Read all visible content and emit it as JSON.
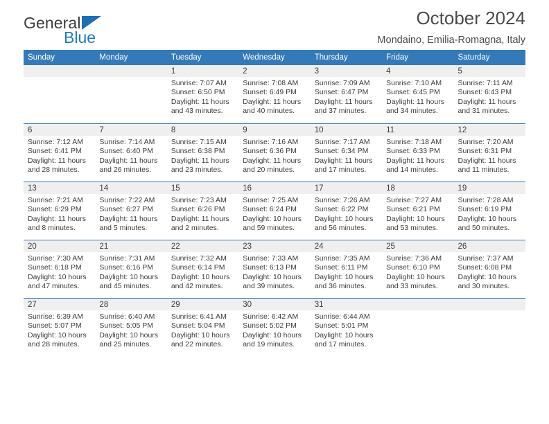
{
  "brand": {
    "name_top": "General",
    "name_bottom": "Blue",
    "triangle_color": "#1f6fb5",
    "blue_text_color": "#1f7ac0"
  },
  "header": {
    "title": "October 2024",
    "subtitle": "Mondaino, Emilia-Romagna, Italy"
  },
  "theme": {
    "header_bg": "#357ab8",
    "header_text": "#ffffff",
    "daynum_band_bg": "#efefef",
    "separator": "#357ab8",
    "body_text": "#3c3c3c"
  },
  "calendar": {
    "weekday_headers": [
      "Sunday",
      "Monday",
      "Tuesday",
      "Wednesday",
      "Thursday",
      "Friday",
      "Saturday"
    ],
    "labels": {
      "sunrise": "Sunrise:",
      "sunset": "Sunset:",
      "daylight": "Daylight:"
    },
    "weeks": [
      [
        {
          "day": "",
          "sunrise": "",
          "sunset": "",
          "daylight": ""
        },
        {
          "day": "",
          "sunrise": "",
          "sunset": "",
          "daylight": ""
        },
        {
          "day": "1",
          "sunrise": "Sunrise: 7:07 AM",
          "sunset": "Sunset: 6:50 PM",
          "daylight": "Daylight: 11 hours and 43 minutes."
        },
        {
          "day": "2",
          "sunrise": "Sunrise: 7:08 AM",
          "sunset": "Sunset: 6:49 PM",
          "daylight": "Daylight: 11 hours and 40 minutes."
        },
        {
          "day": "3",
          "sunrise": "Sunrise: 7:09 AM",
          "sunset": "Sunset: 6:47 PM",
          "daylight": "Daylight: 11 hours and 37 minutes."
        },
        {
          "day": "4",
          "sunrise": "Sunrise: 7:10 AM",
          "sunset": "Sunset: 6:45 PM",
          "daylight": "Daylight: 11 hours and 34 minutes."
        },
        {
          "day": "5",
          "sunrise": "Sunrise: 7:11 AM",
          "sunset": "Sunset: 6:43 PM",
          "daylight": "Daylight: 11 hours and 31 minutes."
        }
      ],
      [
        {
          "day": "6",
          "sunrise": "Sunrise: 7:12 AM",
          "sunset": "Sunset: 6:41 PM",
          "daylight": "Daylight: 11 hours and 28 minutes."
        },
        {
          "day": "7",
          "sunrise": "Sunrise: 7:14 AM",
          "sunset": "Sunset: 6:40 PM",
          "daylight": "Daylight: 11 hours and 26 minutes."
        },
        {
          "day": "8",
          "sunrise": "Sunrise: 7:15 AM",
          "sunset": "Sunset: 6:38 PM",
          "daylight": "Daylight: 11 hours and 23 minutes."
        },
        {
          "day": "9",
          "sunrise": "Sunrise: 7:16 AM",
          "sunset": "Sunset: 6:36 PM",
          "daylight": "Daylight: 11 hours and 20 minutes."
        },
        {
          "day": "10",
          "sunrise": "Sunrise: 7:17 AM",
          "sunset": "Sunset: 6:34 PM",
          "daylight": "Daylight: 11 hours and 17 minutes."
        },
        {
          "day": "11",
          "sunrise": "Sunrise: 7:18 AM",
          "sunset": "Sunset: 6:33 PM",
          "daylight": "Daylight: 11 hours and 14 minutes."
        },
        {
          "day": "12",
          "sunrise": "Sunrise: 7:20 AM",
          "sunset": "Sunset: 6:31 PM",
          "daylight": "Daylight: 11 hours and 11 minutes."
        }
      ],
      [
        {
          "day": "13",
          "sunrise": "Sunrise: 7:21 AM",
          "sunset": "Sunset: 6:29 PM",
          "daylight": "Daylight: 11 hours and 8 minutes."
        },
        {
          "day": "14",
          "sunrise": "Sunrise: 7:22 AM",
          "sunset": "Sunset: 6:27 PM",
          "daylight": "Daylight: 11 hours and 5 minutes."
        },
        {
          "day": "15",
          "sunrise": "Sunrise: 7:23 AM",
          "sunset": "Sunset: 6:26 PM",
          "daylight": "Daylight: 11 hours and 2 minutes."
        },
        {
          "day": "16",
          "sunrise": "Sunrise: 7:25 AM",
          "sunset": "Sunset: 6:24 PM",
          "daylight": "Daylight: 10 hours and 59 minutes."
        },
        {
          "day": "17",
          "sunrise": "Sunrise: 7:26 AM",
          "sunset": "Sunset: 6:22 PM",
          "daylight": "Daylight: 10 hours and 56 minutes."
        },
        {
          "day": "18",
          "sunrise": "Sunrise: 7:27 AM",
          "sunset": "Sunset: 6:21 PM",
          "daylight": "Daylight: 10 hours and 53 minutes."
        },
        {
          "day": "19",
          "sunrise": "Sunrise: 7:28 AM",
          "sunset": "Sunset: 6:19 PM",
          "daylight": "Daylight: 10 hours and 50 minutes."
        }
      ],
      [
        {
          "day": "20",
          "sunrise": "Sunrise: 7:30 AM",
          "sunset": "Sunset: 6:18 PM",
          "daylight": "Daylight: 10 hours and 47 minutes."
        },
        {
          "day": "21",
          "sunrise": "Sunrise: 7:31 AM",
          "sunset": "Sunset: 6:16 PM",
          "daylight": "Daylight: 10 hours and 45 minutes."
        },
        {
          "day": "22",
          "sunrise": "Sunrise: 7:32 AM",
          "sunset": "Sunset: 6:14 PM",
          "daylight": "Daylight: 10 hours and 42 minutes."
        },
        {
          "day": "23",
          "sunrise": "Sunrise: 7:33 AM",
          "sunset": "Sunset: 6:13 PM",
          "daylight": "Daylight: 10 hours and 39 minutes."
        },
        {
          "day": "24",
          "sunrise": "Sunrise: 7:35 AM",
          "sunset": "Sunset: 6:11 PM",
          "daylight": "Daylight: 10 hours and 36 minutes."
        },
        {
          "day": "25",
          "sunrise": "Sunrise: 7:36 AM",
          "sunset": "Sunset: 6:10 PM",
          "daylight": "Daylight: 10 hours and 33 minutes."
        },
        {
          "day": "26",
          "sunrise": "Sunrise: 7:37 AM",
          "sunset": "Sunset: 6:08 PM",
          "daylight": "Daylight: 10 hours and 30 minutes."
        }
      ],
      [
        {
          "day": "27",
          "sunrise": "Sunrise: 6:39 AM",
          "sunset": "Sunset: 5:07 PM",
          "daylight": "Daylight: 10 hours and 28 minutes."
        },
        {
          "day": "28",
          "sunrise": "Sunrise: 6:40 AM",
          "sunset": "Sunset: 5:05 PM",
          "daylight": "Daylight: 10 hours and 25 minutes."
        },
        {
          "day": "29",
          "sunrise": "Sunrise: 6:41 AM",
          "sunset": "Sunset: 5:04 PM",
          "daylight": "Daylight: 10 hours and 22 minutes."
        },
        {
          "day": "30",
          "sunrise": "Sunrise: 6:42 AM",
          "sunset": "Sunset: 5:02 PM",
          "daylight": "Daylight: 10 hours and 19 minutes."
        },
        {
          "day": "31",
          "sunrise": "Sunrise: 6:44 AM",
          "sunset": "Sunset: 5:01 PM",
          "daylight": "Daylight: 10 hours and 17 minutes."
        },
        {
          "day": "",
          "sunrise": "",
          "sunset": "",
          "daylight": ""
        },
        {
          "day": "",
          "sunrise": "",
          "sunset": "",
          "daylight": ""
        }
      ]
    ]
  }
}
